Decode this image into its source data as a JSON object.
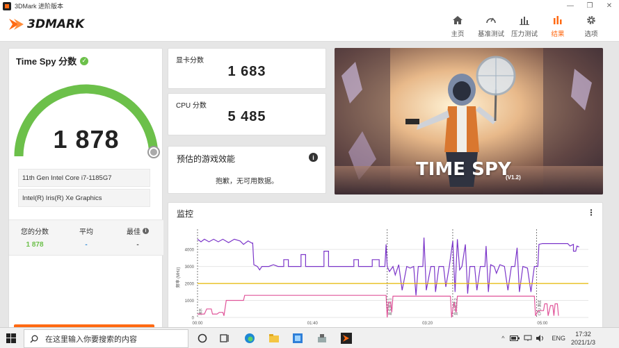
{
  "window": {
    "title": "3DMark 进阶版本",
    "minimize": "—",
    "maximize": "❐",
    "close": "✕"
  },
  "header": {
    "logo": "3DMARK",
    "nav": [
      {
        "label": "主页",
        "icon": "home-icon"
      },
      {
        "label": "基准测试",
        "icon": "gauge-icon"
      },
      {
        "label": "压力测试",
        "icon": "bar-chart-icon"
      },
      {
        "label": "结果",
        "icon": "results-icon",
        "active": true
      },
      {
        "label": "选项",
        "icon": "gear-icon"
      }
    ]
  },
  "score_panel": {
    "title": "Time Spy 分数",
    "score": "1 878",
    "cpu": "11th Gen Intel Core i7-1185G7",
    "gpu": "Intel(R) Iris(R) Xe Graphics",
    "your_score_label": "您的分数",
    "your_score": "1 878",
    "average_label": "平均",
    "average": "-",
    "best_label": "最佳",
    "best": "-"
  },
  "graphics": {
    "label": "显卡分数",
    "value": "1 683"
  },
  "cpu_score": {
    "label": "CPU 分数",
    "value": "5 485"
  },
  "estimate": {
    "title": "预估的游戏效能",
    "note": "抱歉，无可用数据。"
  },
  "hero": {
    "title": "TIME SPY",
    "version": "(V1.2)"
  },
  "monitor": {
    "title": "监控",
    "menu": "⋮"
  },
  "chart_data": {
    "type": "line",
    "ylabel": "频率 (MHz)",
    "y_ticks": [
      "0",
      "1000",
      "2000",
      "3000",
      "4000"
    ],
    "x_ticks": [
      "00:00",
      "01:40",
      "03:20",
      "05:00"
    ],
    "ylim": [
      0,
      4700
    ],
    "xlim": [
      0,
      340
    ],
    "markers": [
      {
        "t": 0,
        "label": "演示"
      },
      {
        "t": 165,
        "label": "显卡测试 1"
      },
      {
        "t": 222,
        "label": "显卡测试 2"
      },
      {
        "t": 295,
        "label": "CPU 测试"
      }
    ],
    "series": [
      {
        "color": "#7b35c9",
        "points": [
          [
            0,
            4600
          ],
          [
            3,
            4450
          ],
          [
            6,
            4600
          ],
          [
            10,
            4450
          ],
          [
            14,
            4600
          ],
          [
            18,
            4450
          ],
          [
            22,
            4600
          ],
          [
            27,
            4400
          ],
          [
            32,
            4600
          ],
          [
            37,
            4500
          ],
          [
            40,
            4300
          ],
          [
            44,
            4500
          ],
          [
            48,
            4350
          ],
          [
            48,
            4400
          ],
          [
            49,
            3100
          ],
          [
            52,
            3000
          ],
          [
            54,
            2800
          ],
          [
            56,
            3000
          ],
          [
            62,
            3000
          ],
          [
            66,
            3100
          ],
          [
            70,
            3000
          ],
          [
            75,
            3000
          ],
          [
            75,
            3400
          ],
          [
            79,
            3400
          ],
          [
            79,
            3000
          ],
          [
            90,
            3000
          ],
          [
            90,
            3700
          ],
          [
            94,
            3700
          ],
          [
            94,
            3000
          ],
          [
            106,
            3000
          ],
          [
            110,
            3000
          ],
          [
            110,
            3900
          ],
          [
            114,
            3900
          ],
          [
            114,
            3000
          ],
          [
            136,
            3000
          ],
          [
            136,
            3400
          ],
          [
            140,
            3400
          ],
          [
            140,
            3000
          ],
          [
            152,
            3000
          ],
          [
            152,
            3400
          ],
          [
            158,
            3400
          ],
          [
            158,
            3000
          ],
          [
            163,
            3000
          ],
          [
            164,
            4300
          ],
          [
            165,
            3000
          ],
          [
            167,
            2700
          ],
          [
            170,
            3000
          ],
          [
            172,
            2500
          ],
          [
            175,
            3100
          ],
          [
            178,
            1600
          ],
          [
            182,
            3000
          ],
          [
            185,
            2900
          ],
          [
            188,
            3000
          ],
          [
            190,
            1300
          ],
          [
            192,
            3000
          ],
          [
            196,
            3000
          ],
          [
            197,
            4700
          ],
          [
            199,
            1600
          ],
          [
            203,
            3000
          ],
          [
            206,
            3000
          ],
          [
            207,
            1500
          ],
          [
            210,
            3000
          ],
          [
            214,
            3000
          ],
          [
            216,
            1800
          ],
          [
            219,
            3000
          ],
          [
            222,
            4500
          ],
          [
            224,
            1500
          ],
          [
            226,
            4600
          ],
          [
            228,
            2800
          ],
          [
            230,
            3000
          ],
          [
            233,
            4300
          ],
          [
            235,
            1400
          ],
          [
            237,
            3000
          ],
          [
            241,
            3000
          ],
          [
            243,
            1600
          ],
          [
            246,
            3000
          ],
          [
            250,
            3000
          ],
          [
            251,
            4200
          ],
          [
            253,
            1500
          ],
          [
            255,
            3100
          ],
          [
            258,
            3000
          ],
          [
            260,
            2600
          ],
          [
            263,
            3100
          ],
          [
            267,
            3000
          ],
          [
            270,
            1600
          ],
          [
            273,
            3000
          ],
          [
            276,
            3000
          ],
          [
            278,
            4100
          ],
          [
            280,
            1500
          ],
          [
            283,
            3000
          ],
          [
            287,
            2900
          ],
          [
            290,
            1500
          ],
          [
            293,
            3000
          ],
          [
            296,
            3000
          ],
          [
            297,
            4300
          ],
          [
            300,
            4350
          ],
          [
            310,
            4350
          ],
          [
            322,
            4350
          ],
          [
            324,
            4200
          ],
          [
            327,
            4300
          ],
          [
            327,
            3900
          ],
          [
            329,
            3900
          ],
          [
            330,
            4200
          ],
          [
            332,
            4150
          ]
        ]
      },
      {
        "color": "#e6b800",
        "points": [
          [
            0,
            2000
          ],
          [
            340,
            2000
          ]
        ]
      },
      {
        "color": "#e0559a",
        "points": [
          [
            0,
            200
          ],
          [
            6,
            200
          ],
          [
            8,
            500
          ],
          [
            12,
            500
          ],
          [
            13,
            200
          ],
          [
            17,
            200
          ],
          [
            19,
            300
          ],
          [
            22,
            300
          ],
          [
            23,
            100
          ],
          [
            25,
            1000
          ],
          [
            40,
            1000
          ],
          [
            41,
            1300
          ],
          [
            164,
            1300
          ],
          [
            165,
            0
          ],
          [
            166,
            900
          ],
          [
            168,
            900
          ],
          [
            169,
            300
          ],
          [
            170,
            1250
          ],
          [
            220,
            1250
          ],
          [
            221,
            0
          ],
          [
            223,
            900
          ],
          [
            225,
            300
          ],
          [
            226,
            1250
          ],
          [
            293,
            1250
          ],
          [
            294,
            100
          ],
          [
            296,
            400
          ],
          [
            301,
            400
          ],
          [
            302,
            800
          ],
          [
            304,
            800
          ],
          [
            305,
            100
          ],
          [
            307,
            700
          ],
          [
            309,
            700
          ],
          [
            310,
            100
          ],
          [
            311,
            800
          ],
          [
            313,
            800
          ],
          [
            314,
            100
          ]
        ]
      }
    ]
  },
  "taskbar": {
    "search_placeholder": "在这里输入你要搜索的内容",
    "lang": "ENG",
    "time": "17:32",
    "date": "2021/1/3"
  }
}
